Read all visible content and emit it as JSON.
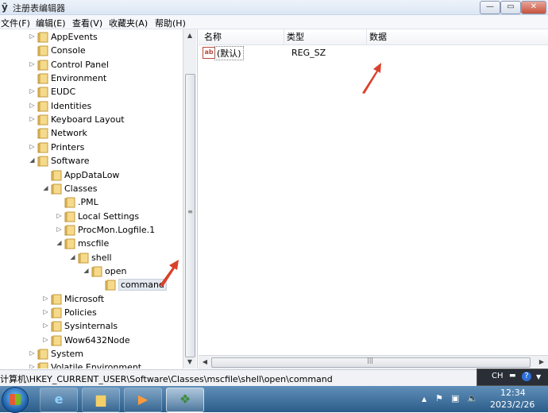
{
  "window": {
    "title": "注册表编辑器",
    "app_icon": "regedit-icon",
    "controls": {
      "min": "—",
      "max": "▭",
      "close": "✕"
    }
  },
  "menu": [
    "文件(F)",
    "编辑(E)",
    "查看(V)",
    "收藏夹(A)",
    "帮助(H)"
  ],
  "tree": {
    "items": [
      {
        "label": "AppEvents",
        "depth": 1,
        "state": "collapsed"
      },
      {
        "label": "Console",
        "depth": 1,
        "state": "none"
      },
      {
        "label": "Control Panel",
        "depth": 1,
        "state": "collapsed"
      },
      {
        "label": "Environment",
        "depth": 1,
        "state": "none"
      },
      {
        "label": "EUDC",
        "depth": 1,
        "state": "collapsed"
      },
      {
        "label": "Identities",
        "depth": 1,
        "state": "collapsed"
      },
      {
        "label": "Keyboard Layout",
        "depth": 1,
        "state": "collapsed"
      },
      {
        "label": "Network",
        "depth": 1,
        "state": "none"
      },
      {
        "label": "Printers",
        "depth": 1,
        "state": "collapsed"
      },
      {
        "label": "Software",
        "depth": 1,
        "state": "expanded"
      },
      {
        "label": "AppDataLow",
        "depth": 2,
        "state": "none"
      },
      {
        "label": "Classes",
        "depth": 2,
        "state": "expanded"
      },
      {
        "label": ".PML",
        "depth": 3,
        "state": "none"
      },
      {
        "label": "Local Settings",
        "depth": 3,
        "state": "collapsed"
      },
      {
        "label": "ProcMon.Logfile.1",
        "depth": 3,
        "state": "collapsed"
      },
      {
        "label": "mscfile",
        "depth": 3,
        "state": "expanded"
      },
      {
        "label": "shell",
        "depth": 4,
        "state": "expanded"
      },
      {
        "label": "open",
        "depth": 5,
        "state": "expanded"
      },
      {
        "label": "command",
        "depth": 6,
        "state": "none",
        "selected": true
      },
      {
        "label": "Microsoft",
        "depth": 2,
        "state": "collapsed"
      },
      {
        "label": "Policies",
        "depth": 2,
        "state": "collapsed"
      },
      {
        "label": "Sysinternals",
        "depth": 2,
        "state": "collapsed"
      },
      {
        "label": "Wow6432Node",
        "depth": 2,
        "state": "collapsed"
      },
      {
        "label": "System",
        "depth": 1,
        "state": "collapsed"
      },
      {
        "label": "Volatile Environment",
        "depth": 1,
        "state": "collapsed"
      }
    ]
  },
  "list": {
    "columns": [
      "名称",
      "类型",
      "数据"
    ],
    "rows": [
      {
        "name": "(默认)",
        "type": "REG_SZ",
        "data": ""
      }
    ]
  },
  "status": {
    "path": "计算机\\HKEY_CURRENT_USER\\Software\\Classes\\mscfile\\shell\\open\\command"
  },
  "langbar": {
    "lang": "CH",
    "help": "?"
  },
  "taskbar": {
    "clock_time": "12:34",
    "clock_date": "2023/2/26"
  },
  "colors": {
    "annotation_arrow": "#d9412b",
    "taskbar": "#3a6c99"
  }
}
